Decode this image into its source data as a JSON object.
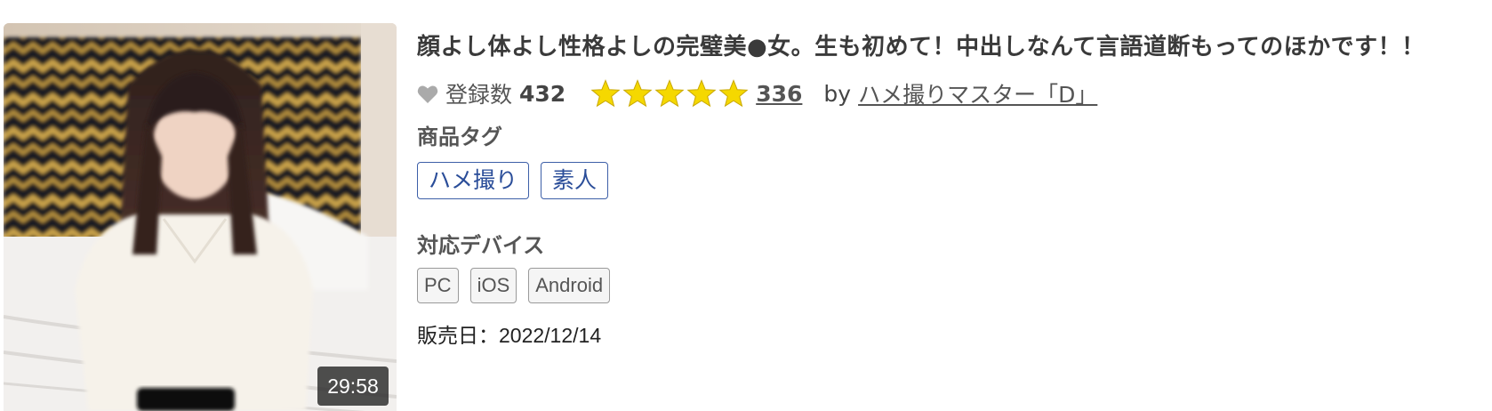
{
  "product": {
    "title": "顔よし体よし性格よしの完璧美●女。生も初めて！中出しなんて言語道断もってのほかです！！",
    "duration": "29:58",
    "favorites": {
      "icon": "heart-icon",
      "label": "登録数",
      "count": "432"
    },
    "rating": {
      "stars": 5,
      "max_stars": 5,
      "star_color": "#f5d800",
      "review_count": "336"
    },
    "seller": {
      "by_label": "by",
      "name": "ハメ撮りマスター「D」"
    },
    "tags_label": "商品タグ",
    "tags": [
      {
        "label": "ハメ撮り"
      },
      {
        "label": "素人"
      }
    ],
    "devices_label": "対応デバイス",
    "devices": [
      {
        "label": "PC"
      },
      {
        "label": "iOS"
      },
      {
        "label": "Android"
      }
    ],
    "release": {
      "label": "販売日：",
      "date": "2022/12/14"
    }
  },
  "colors": {
    "tag_border": "#3d5fa8",
    "tag_text": "#2a4d99",
    "device_border": "#9a9a9a",
    "star": "#f5d800",
    "heart": "#aaaaaa"
  }
}
